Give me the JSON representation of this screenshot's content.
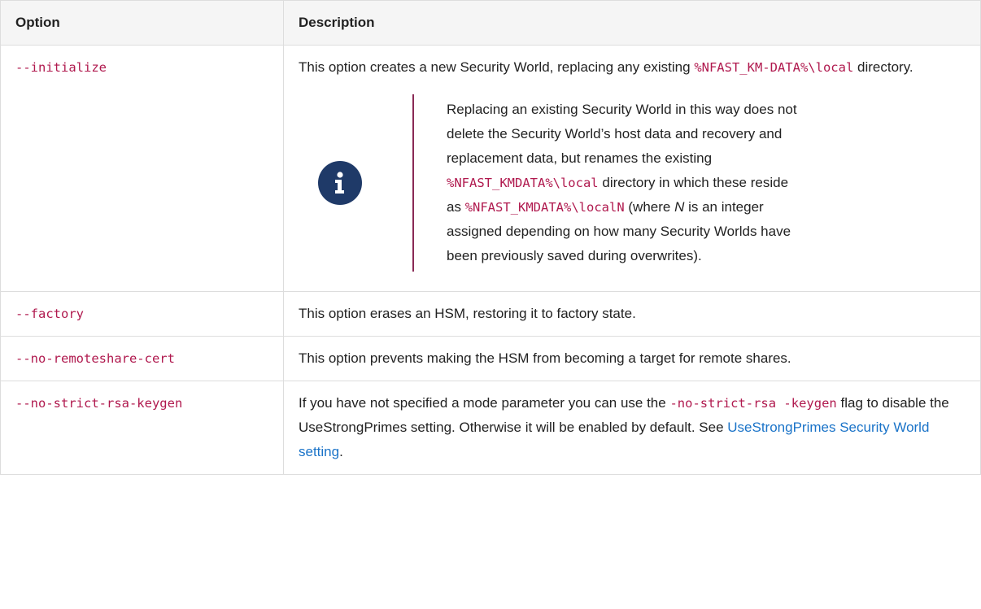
{
  "header": {
    "option": "Option",
    "description": "Description"
  },
  "rows": [
    {
      "option": "--initialize",
      "desc_before": "This option creates a new Security World, replacing any existing ",
      "desc_code": "%NFAST_KM-DATA%\\local",
      "desc_after": " directory.",
      "note": {
        "icon": "info-icon",
        "t1": "Replacing an existing Security World in this way does not delete the Security World’s host data and recovery and replacement data, but renames the existing ",
        "c1": "%NFAST_KMDATA%\\local",
        "t2": " directory in which these reside as ",
        "c2": "%NFAST_KMDATA%\\localN",
        "t3": " (where ",
        "em": "N",
        "t4": " is an integer assigned depending on how many Security Worlds have been previously saved during overwrites)."
      }
    },
    {
      "option": "--factory",
      "desc": "This option erases an HSM, restoring it to factory state."
    },
    {
      "option": "--no-remoteshare-cert",
      "desc": "This option prevents making the HSM from becoming a target for remote shares."
    },
    {
      "option": "--no-strict-rsa-keygen",
      "desc_before": "If you have not specified a mode parameter you can use the ",
      "desc_code": "-no-strict-rsa -keygen",
      "desc_mid": " flag to disable the UseStrongPrimes setting. Otherwise it will be enabled by default. See ",
      "desc_link": "UseStrongPrimes Security World setting",
      "desc_after": "."
    }
  ],
  "colors": {
    "code": "#b0194e",
    "link": "#1a73c8",
    "note_bar": "#8a2a55",
    "icon_bg": "#1f3a68"
  }
}
